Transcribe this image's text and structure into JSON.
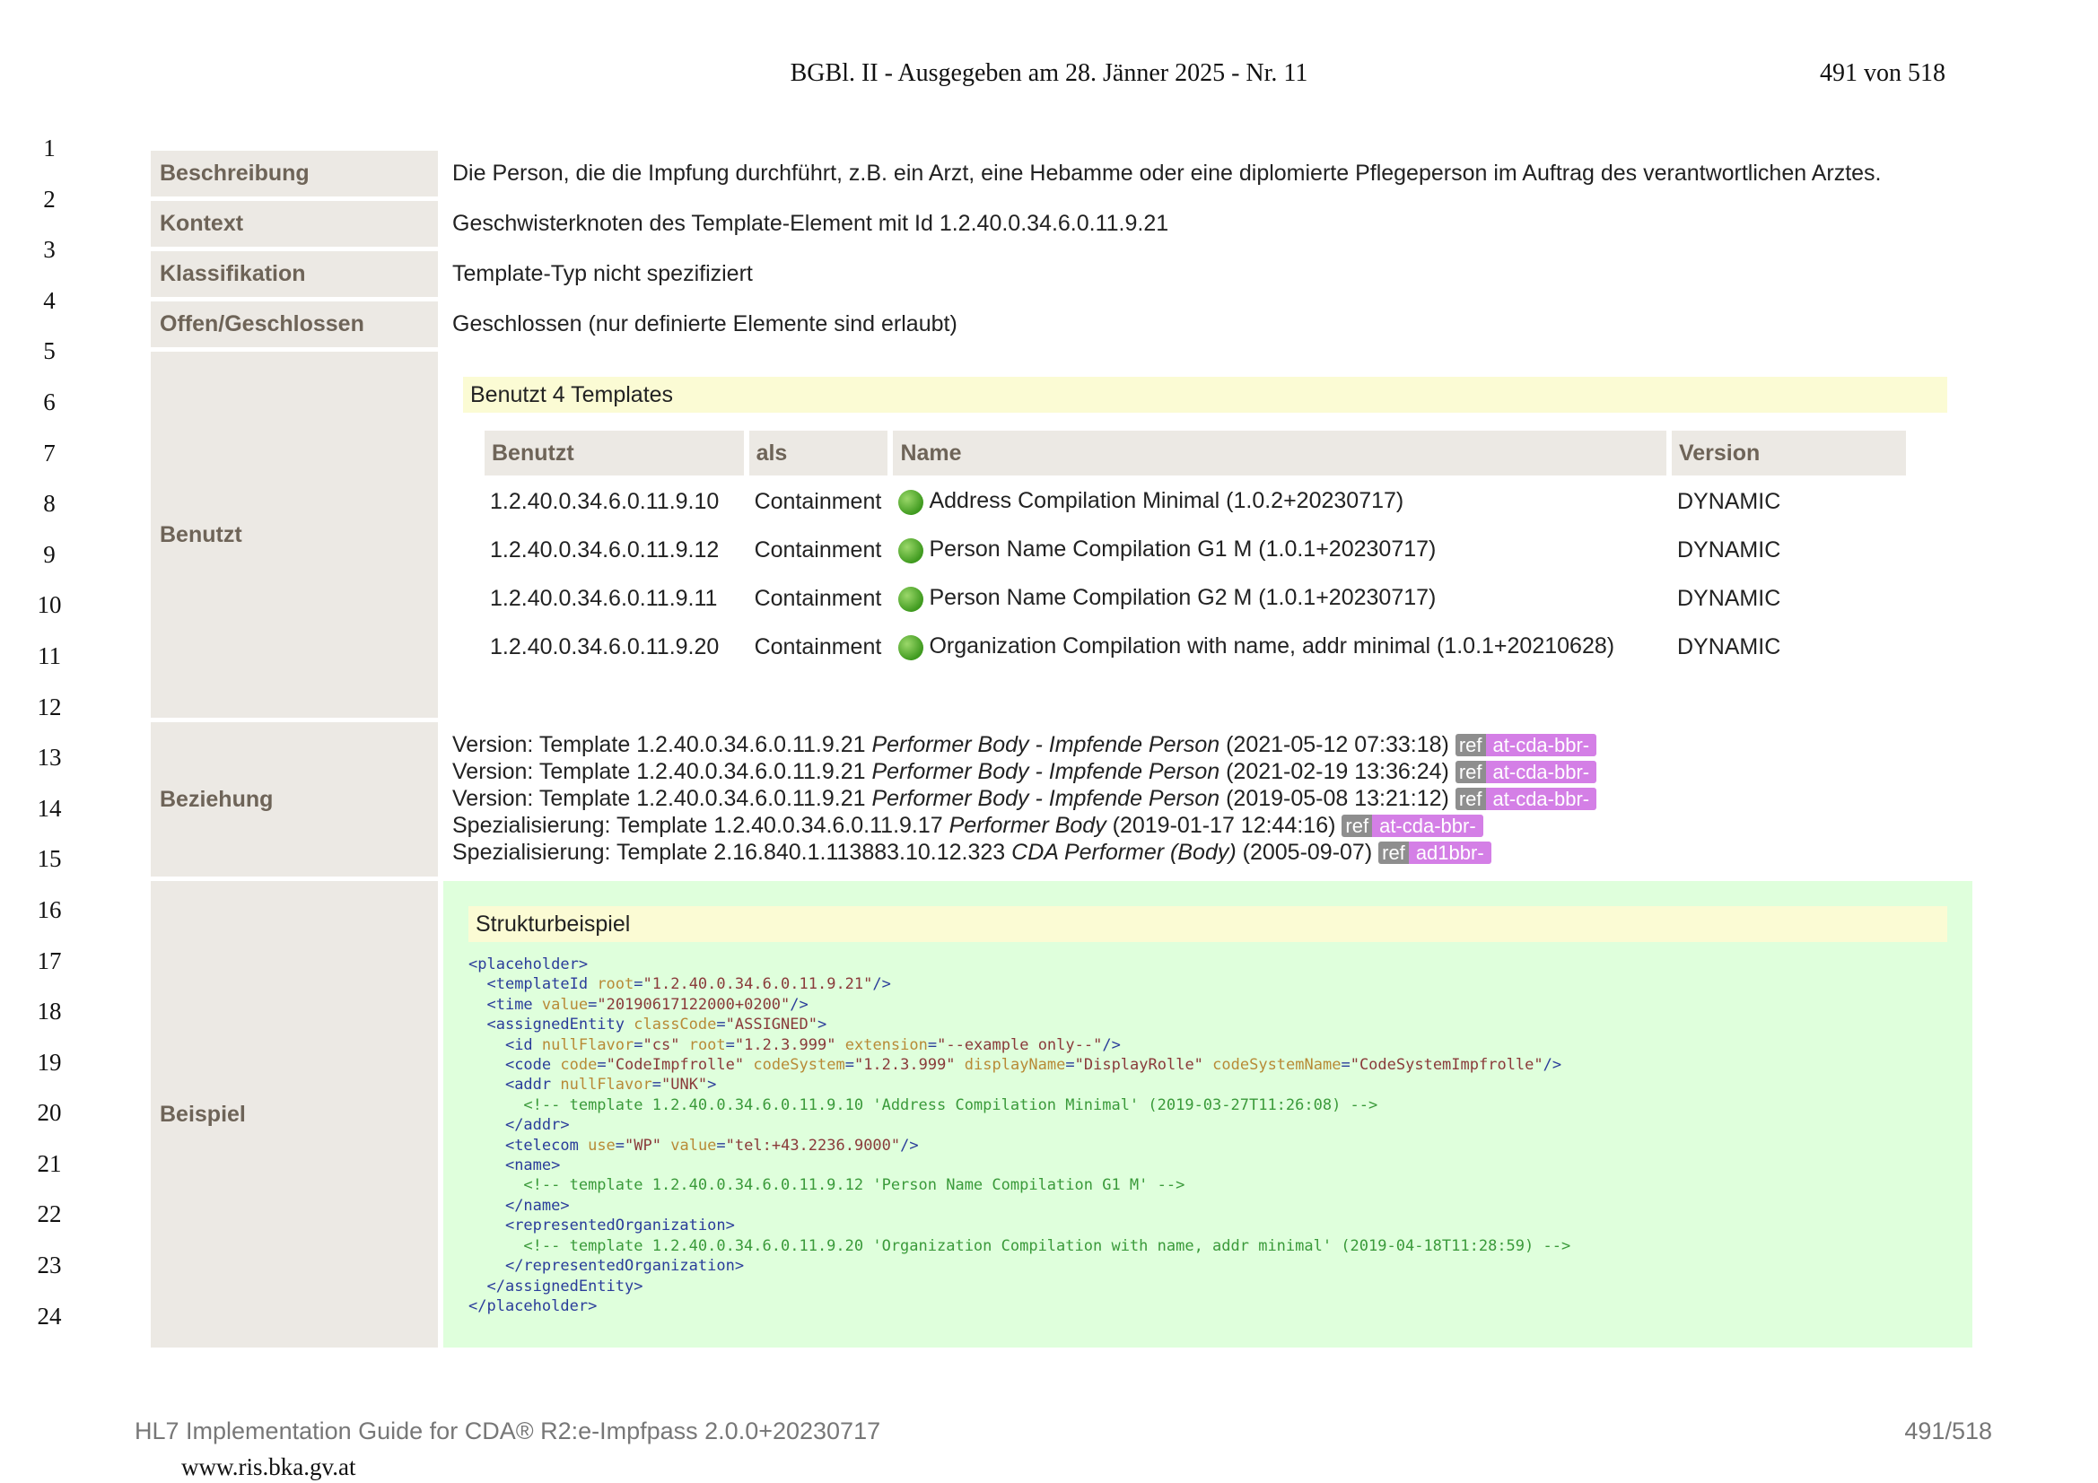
{
  "header": {
    "title": "BGBl. II - Ausgegeben am 28. Jänner 2025 - Nr. 11",
    "page": "491 von 518"
  },
  "line_numbers": [
    "1",
    "2",
    "3",
    "4",
    "5",
    "6",
    "7",
    "8",
    "9",
    "10",
    "11",
    "12",
    "13",
    "14",
    "15",
    "16",
    "17",
    "18",
    "19",
    "20",
    "21",
    "22",
    "23",
    "24"
  ],
  "rows": {
    "beschreibung": {
      "label": "Beschreibung",
      "value": "Die Person, die die Impfung durchführt, z.B. ein Arzt, eine Hebamme oder eine diplomierte Pflegeperson im Auftrag des verantwortlichen Arztes."
    },
    "kontext": {
      "label": "Kontext",
      "value": "Geschwisterknoten des Template-Element mit Id 1.2.40.0.34.6.0.11.9.21"
    },
    "klassifikation": {
      "label": "Klassifikation",
      "value": "Template-Typ nicht spezifiziert"
    },
    "offen": {
      "label": "Offen/Geschlossen",
      "value": "Geschlossen (nur definierte Elemente sind erlaubt)"
    },
    "benutzt": {
      "label": "Benutzt",
      "box_title": "Benutzt 4 Templates",
      "columns": [
        "Benutzt",
        "als",
        "Name",
        "Version"
      ],
      "templates": [
        {
          "id": "1.2.40.0.34.6.0.11.9.10",
          "als": "Containment",
          "name": "Address Compilation Minimal (1.0.2+20230717)",
          "version": "DYNAMIC"
        },
        {
          "id": "1.2.40.0.34.6.0.11.9.12",
          "als": "Containment",
          "name": "Person Name Compilation G1 M (1.0.1+20230717)",
          "version": "DYNAMIC"
        },
        {
          "id": "1.2.40.0.34.6.0.11.9.11",
          "als": "Containment",
          "name": "Person Name Compilation G2 M (1.0.1+20230717)",
          "version": "DYNAMIC"
        },
        {
          "id": "1.2.40.0.34.6.0.11.9.20",
          "als": "Containment",
          "name": "Organization Compilation with name, addr minimal (1.0.1+20210628)",
          "version": "DYNAMIC"
        }
      ]
    },
    "beziehung": {
      "label": "Beziehung",
      "lines": [
        {
          "prefix": "Version: Template 1.2.40.0.34.6.0.11.9.21 ",
          "italic": "Performer Body - Impfende Person",
          "suffix": " (2021‑05‑12 07:33:18) ",
          "ref": "ref",
          "tag": "at-cda-bbr-"
        },
        {
          "prefix": "Version: Template 1.2.40.0.34.6.0.11.9.21 ",
          "italic": "Performer Body - Impfende Person",
          "suffix": " (2021‑02‑19 13:36:24) ",
          "ref": "ref",
          "tag": "at-cda-bbr-"
        },
        {
          "prefix": "Version: Template 1.2.40.0.34.6.0.11.9.21 ",
          "italic": "Performer Body - Impfende Person",
          "suffix": " (2019‑05‑08 13:21:12) ",
          "ref": "ref",
          "tag": "at-cda-bbr-"
        },
        {
          "prefix": "Spezialisierung: Template 1.2.40.0.34.6.0.11.9.17 ",
          "italic": "Performer Body",
          "suffix": " (2019‑01‑17 12:44:16) ",
          "ref": "ref",
          "tag": "at-cda-bbr-"
        },
        {
          "prefix": "Spezialisierung: Template 2.16.840.1.113883.10.12.323 ",
          "italic": "CDA Performer (Body)",
          "suffix": " (2005‑09‑07) ",
          "ref": "ref",
          "tag": "ad1bbr-"
        }
      ]
    },
    "beispiel": {
      "label": "Beispiel",
      "box_title": "Strukturbeispiel",
      "code": [
        "<placeholder>",
        "  <templateId root=\"1.2.40.0.34.6.0.11.9.21\"/>",
        "  <time value=\"20190617122000+0200\"/>",
        "  <assignedEntity classCode=\"ASSIGNED\">",
        "    <id nullFlavor=\"cs\" root=\"1.2.3.999\" extension=\"--example only--\"/>",
        "    <code code=\"CodeImpfrolle\" codeSystem=\"1.2.3.999\" displayName=\"DisplayRolle\" codeSystemName=\"CodeSystemImpfrolle\"/>",
        "    <addr nullFlavor=\"UNK\">",
        "      <!-- template 1.2.40.0.34.6.0.11.9.10 'Address Compilation Minimal' (2019-03-27T11:26:08) -->",
        "    </addr>",
        "    <telecom use=\"WP\" value=\"tel:+43.2236.9000\"/>",
        "    <name>",
        "      <!-- template 1.2.40.0.34.6.0.11.9.12 'Person Name Compilation G1 M' -->",
        "    </name>",
        "    <representedOrganization>",
        "      <!-- template 1.2.40.0.34.6.0.11.9.20 'Organization Compilation with name, addr minimal' (2019-04-18T11:28:59) -->",
        "    </representedOrganization>",
        "  </assignedEntity>",
        "</placeholder>"
      ]
    }
  },
  "footer": {
    "left": "HL7 Implementation Guide for CDA® R2:e-Impfpass 2.0.0+20230717",
    "right": "491/518",
    "url": "www.ris.bka.gv.at"
  },
  "colors": {
    "label_bg": "#ece9e4",
    "label_text": "#6e6458",
    "yellow_box": "#fbfbd4",
    "green_box": "#dfffdc",
    "ref_gray": "#8e8e8e",
    "ref_purple": "#d47fe6"
  }
}
